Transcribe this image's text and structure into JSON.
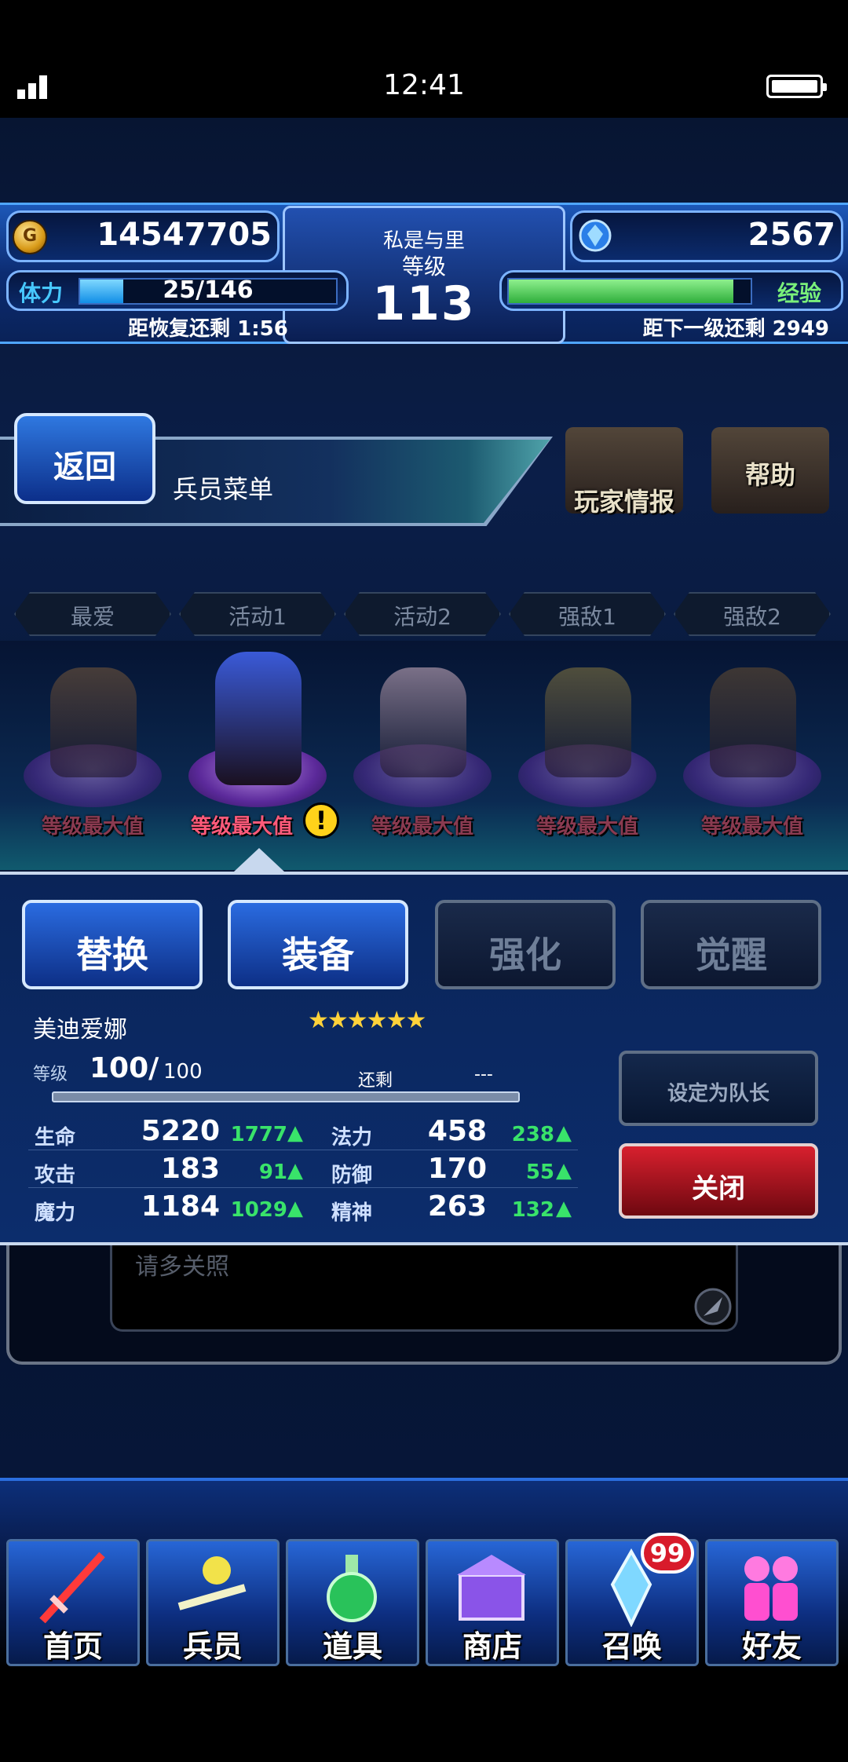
{
  "status_bar": {
    "time": "12:41"
  },
  "header": {
    "gil": "14547705",
    "player_name": "私是与里",
    "level_label": "等级",
    "level": "113",
    "lapis": "2567",
    "stamina_label": "体力",
    "stamina_value": "25/146",
    "stamina_fraction": 0.17,
    "recovery_text": "距恢复还剩 1:56",
    "exp_label": "经验",
    "exp_fraction": 0.93,
    "next_level_text": "距下一级还剩 2949"
  },
  "nav_top": {
    "back_label": "返回",
    "menu_title": "兵员菜单",
    "player_info_label": "玩家情报",
    "help_label": "帮助"
  },
  "party_tabs": [
    "最爱",
    "活动1",
    "活动2",
    "强敌1",
    "强敌2"
  ],
  "units": [
    {
      "status": "等级最大值",
      "color": "#7a5a3a"
    },
    {
      "status": "等级最大值",
      "color": "#3a5ad8"
    },
    {
      "status": "等级最大值",
      "color": "#d8b8c8"
    },
    {
      "status": "等级最大值",
      "color": "#8a7a40"
    },
    {
      "status": "等级最大值",
      "color": "#6a5030"
    }
  ],
  "actions": {
    "replace": "替换",
    "equip": "装备",
    "enhance": "强化",
    "awaken": "觉醒"
  },
  "unit_detail": {
    "name": "美迪爱娜",
    "stars": "★★★★★★",
    "level_label": "等级",
    "level_current": "100/",
    "level_max": "100",
    "remain_label": "还剩",
    "remain_value": "---",
    "stats": [
      {
        "label": "生命",
        "value": "5220",
        "bonus": "1777",
        "label2": "法力",
        "value2": "458",
        "bonus2": "238"
      },
      {
        "label": "攻击",
        "value": "183",
        "bonus": "91",
        "label2": "防御",
        "value2": "170",
        "bonus2": "55"
      },
      {
        "label": "魔力",
        "value": "1184",
        "bonus": "1029",
        "label2": "精神",
        "value2": "263",
        "bonus2": "132"
      }
    ],
    "leader_button": "设定为队长",
    "close_button": "关闭"
  },
  "comment": "请多关照",
  "bottom_nav": {
    "home": "首页",
    "units": "兵员",
    "items": "道具",
    "shop": "商店",
    "summon": "召唤",
    "summon_badge": "99",
    "friends": "好友"
  }
}
